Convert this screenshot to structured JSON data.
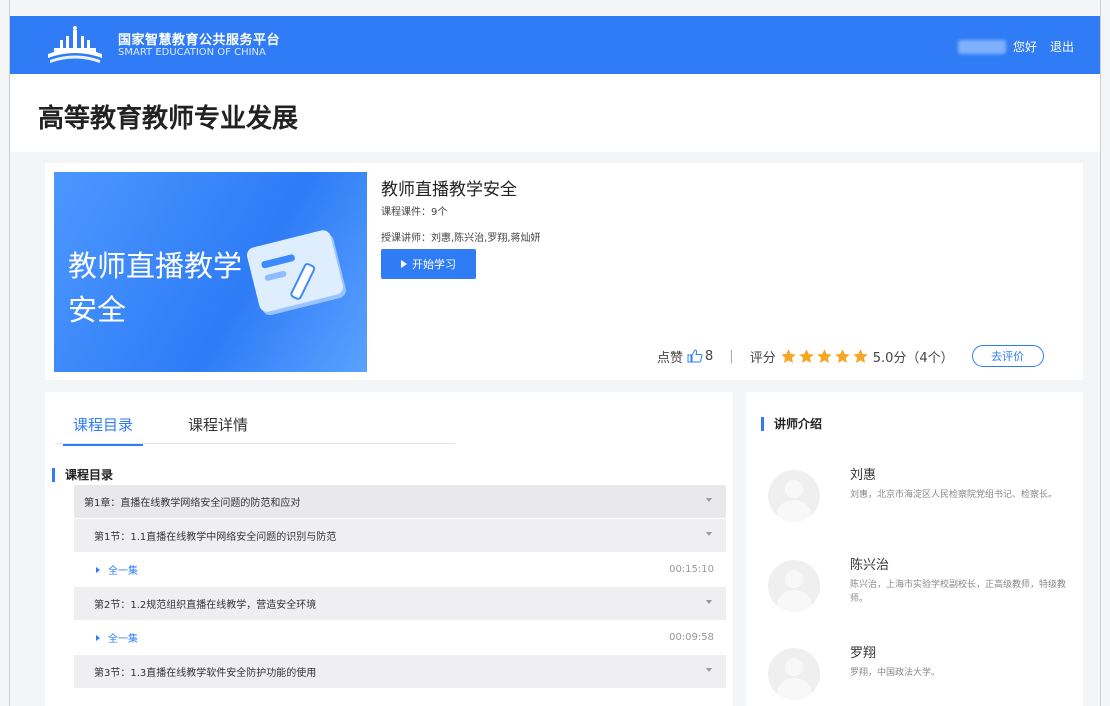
{
  "header": {
    "brand_cn": "国家智慧教育公共服务平台",
    "brand_en": "SMART EDUCATION OF CHINA",
    "greeting": "您好",
    "logout": "退出",
    "bg_color": "#2f7cf6"
  },
  "page": {
    "title": "高等教育教师专业发展"
  },
  "course": {
    "cover_text": "教师直播教学安全",
    "name": "教师直播教学安全",
    "count_text": "课程课件：9个",
    "teachers_text": "授课讲师：刘惠,陈兴治,罗翔,蒋灿妍",
    "start_label": "开始学习",
    "like_label": "点赞",
    "like_count": "8",
    "separator": "|",
    "rating_label": "评分",
    "rating_value": "5.0分（4个）",
    "stars": 5,
    "review_label": "去评价"
  },
  "tabs": {
    "catalog": "课程目录",
    "details": "课程详情"
  },
  "catalog": {
    "heading": "课程目录",
    "rows": [
      {
        "text": "第1章：直播在线教学网络安全问题的防范和应对"
      },
      {
        "text": "第1节：1.1直播在线教学中网络安全问题的识别与防范"
      },
      {
        "text": "全一集",
        "time": "00:15:10"
      },
      {
        "text": "第2节：1.2规范组织直播在线教学，营造安全环境"
      },
      {
        "text": "全一集",
        "time": "00:09:58"
      },
      {
        "text": "第3节：1.3直播在线教学软件安全防护功能的使用"
      }
    ]
  },
  "instructors": {
    "heading": "讲师介绍",
    "list": [
      {
        "name": "刘惠",
        "desc": "刘惠，北京市海淀区人民检察院党组书记、检察长。"
      },
      {
        "name": "陈兴治",
        "desc": "陈兴治，上海市实验学校副校长，正高级教师，特级教师。"
      },
      {
        "name": "罗翔",
        "desc": "罗翔，中国政法大学。"
      }
    ]
  }
}
